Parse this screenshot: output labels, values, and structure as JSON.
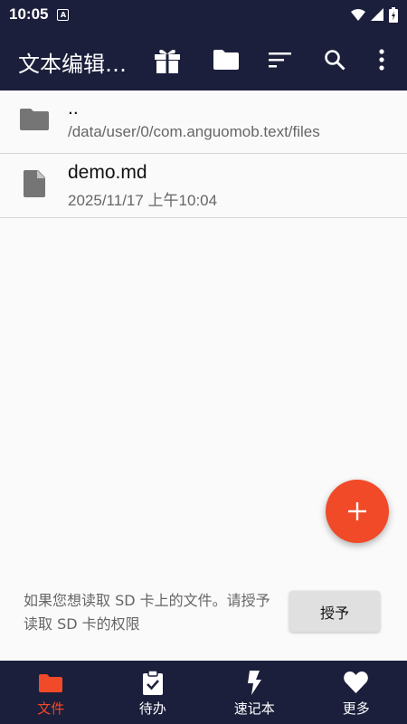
{
  "status_bar": {
    "time": "10:05",
    "notification_badge": "A"
  },
  "app_bar": {
    "title": "文本编辑…",
    "icons": [
      "gift-icon",
      "folder-icon",
      "sort-icon",
      "search-icon",
      "more-vert-icon"
    ]
  },
  "files": [
    {
      "name": "..",
      "subtitle": "/data/user/0/com.anguomob.text/files",
      "icon": "folder-icon"
    },
    {
      "name": "demo.md",
      "subtitle": "2025/11/17 上午10:04",
      "icon": "file-icon"
    }
  ],
  "permission": {
    "message": "如果您想读取 SD 卡上的文件。请授予读取 SD 卡的权限",
    "button": "授予"
  },
  "fab": {
    "icon": "plus-icon"
  },
  "bottom_nav": [
    {
      "label": "文件",
      "icon": "folder-icon",
      "active": true
    },
    {
      "label": "待办",
      "icon": "clipboard-check-icon",
      "active": false
    },
    {
      "label": "速记本",
      "icon": "flash-icon",
      "active": false
    },
    {
      "label": "更多",
      "icon": "heart-icon",
      "active": false
    }
  ],
  "colors": {
    "primary": "#1b1f3b",
    "accent": "#f04a28",
    "background": "#fafafa"
  }
}
